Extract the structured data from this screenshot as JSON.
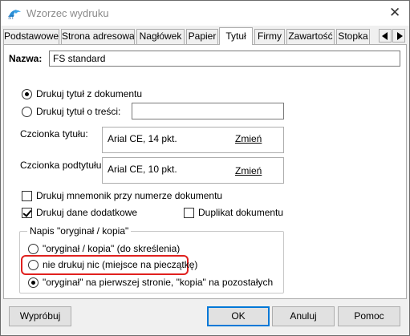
{
  "window": {
    "title": "Wzorzec wydruku",
    "close_glyph": "✕"
  },
  "tabs": [
    {
      "label": "Podstawowe",
      "active": false
    },
    {
      "label": "Strona adresowa",
      "active": false
    },
    {
      "label": "Nagłówek",
      "active": false
    },
    {
      "label": "Papier",
      "active": false
    },
    {
      "label": "Tytuł",
      "active": true
    },
    {
      "label": "Firmy",
      "active": false
    },
    {
      "label": "Zawartość",
      "active": false
    },
    {
      "label": "Stopka",
      "active": false
    }
  ],
  "name_field": {
    "label": "Nazwa:",
    "value": "FS standard"
  },
  "title_source": {
    "option_document": "Drukuj tytuł z dokumentu",
    "option_custom": "Drukuj tytuł o treści:",
    "selected": "document",
    "custom_value": ""
  },
  "fonts": {
    "title_label": "Czcionka tytułu:",
    "title_value": "Arial CE, 14 pkt.",
    "subtitle_label": "Czcionka podtytułu:",
    "subtitle_value": "Arial CE, 10 pkt.",
    "change_link": "Zmień"
  },
  "checkboxes": {
    "mnemonic": {
      "label": "Drukuj mnemonik przy numerze dokumentu",
      "checked": false
    },
    "additional_data": {
      "label": "Drukuj dane dodatkowe",
      "checked": true
    },
    "duplicate": {
      "label": "Duplikat dokumentu",
      "checked": false
    }
  },
  "original_copy_group": {
    "legend": "Napis \"oryginał / kopia\"",
    "options": [
      {
        "label": "\"oryginał / kopia\" (do skreślenia)",
        "selected": false
      },
      {
        "label": "nie drukuj nic (miejsce na pieczątkę)",
        "selected": false,
        "highlighted": true
      },
      {
        "label": "\"oryginał\" na pierwszej stronie, \"kopia\" na pozostałych",
        "selected": true
      }
    ]
  },
  "buttons": {
    "preview": "Wypróbuj",
    "ok": "OK",
    "cancel": "Anuluj",
    "help": "Pomoc"
  },
  "colors": {
    "highlight": "#e0201e",
    "primary_button_border": "#0078d7"
  }
}
